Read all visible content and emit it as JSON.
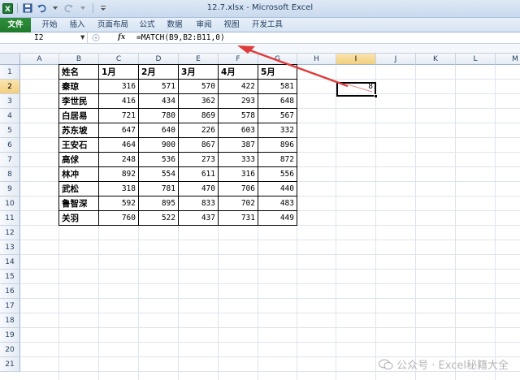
{
  "window": {
    "title": "12.7.xlsx - Microsoft Excel"
  },
  "ribbon": {
    "file_tab": "文件",
    "tabs": [
      "开始",
      "插入",
      "页面布局",
      "公式",
      "数据",
      "审阅",
      "视图",
      "开发工具"
    ]
  },
  "formula_bar": {
    "name_box": "I2",
    "fx_label": "fx",
    "formula": "=MATCH(B9,B2:B11,0)"
  },
  "columns": [
    "A",
    "B",
    "C",
    "D",
    "E",
    "F",
    "G",
    "H",
    "I",
    "J",
    "K",
    "L",
    "M"
  ],
  "rows": [
    "1",
    "2",
    "3",
    "4",
    "5",
    "6",
    "7",
    "8",
    "9",
    "10",
    "11",
    "12",
    "13",
    "14",
    "15",
    "16",
    "17",
    "18",
    "19",
    "20",
    "21"
  ],
  "table": {
    "headers": [
      "姓名",
      "1月",
      "2月",
      "3月",
      "4月",
      "5月"
    ],
    "rows": [
      [
        "秦琼",
        "316",
        "571",
        "570",
        "422",
        "581"
      ],
      [
        "李世民",
        "416",
        "434",
        "362",
        "293",
        "648"
      ],
      [
        "白居易",
        "721",
        "780",
        "869",
        "578",
        "567"
      ],
      [
        "苏东坡",
        "647",
        "640",
        "226",
        "603",
        "332"
      ],
      [
        "王安石",
        "464",
        "900",
        "867",
        "387",
        "896"
      ],
      [
        "高俅",
        "248",
        "536",
        "273",
        "333",
        "872"
      ],
      [
        "林冲",
        "892",
        "554",
        "611",
        "316",
        "556"
      ],
      [
        "武松",
        "318",
        "781",
        "470",
        "706",
        "440"
      ],
      [
        "鲁智深",
        "592",
        "895",
        "833",
        "702",
        "483"
      ],
      [
        "关羽",
        "760",
        "522",
        "437",
        "731",
        "449"
      ]
    ]
  },
  "result_cell": {
    "address": "I2",
    "value": "8"
  },
  "selection": {
    "column": "I",
    "row": "2"
  },
  "annotation": {
    "arrow_color": "#e03b3b"
  },
  "watermark": {
    "text": "公众号 · Excel秘籍大全"
  },
  "colors": {
    "file_tab": "#1e7a2b",
    "selected_header": "#f3cf7c",
    "grid_line": "#dde4ee"
  }
}
